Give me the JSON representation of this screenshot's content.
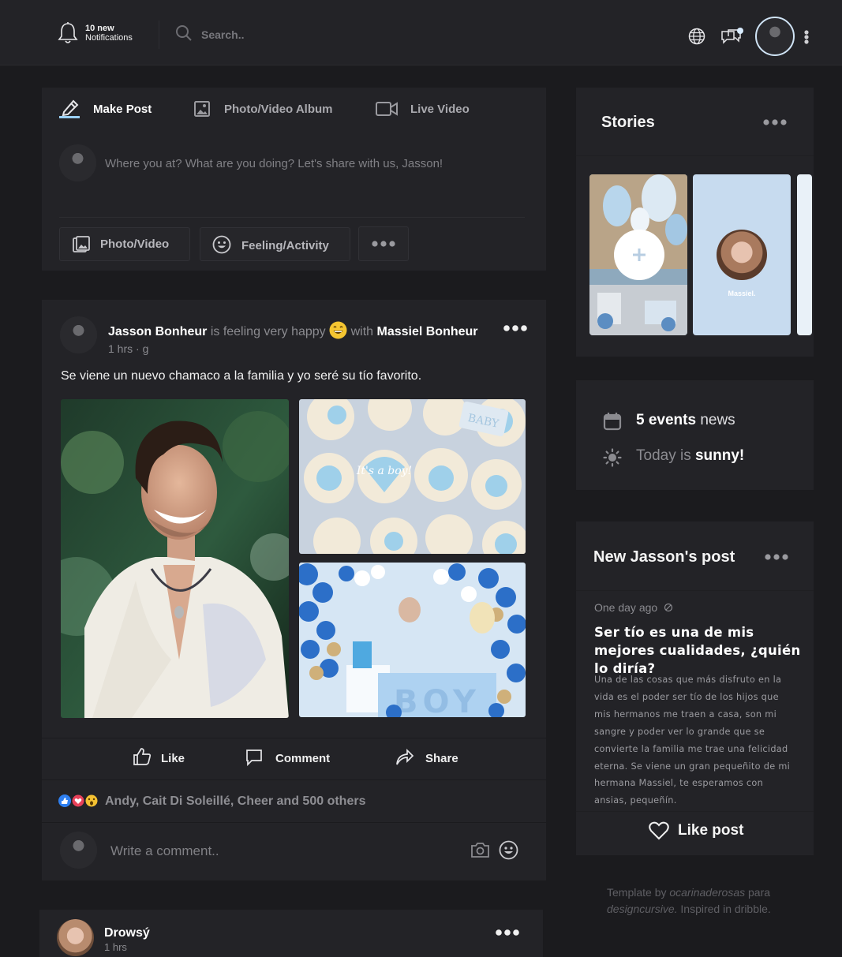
{
  "topbar": {
    "notif_count": "10 new",
    "notif_label": "Notifications",
    "search_placeholder": "Search.."
  },
  "composer": {
    "tabs": [
      {
        "label": "Make Post"
      },
      {
        "label": "Photo/Video Album"
      },
      {
        "label": "Live Video"
      }
    ],
    "placeholder": "Where you at? What are you doing? Let's share with us, Jasson!",
    "buttons": [
      {
        "label": "Photo/Video"
      },
      {
        "label": "Feeling/Activity"
      }
    ]
  },
  "post": {
    "author": "Jasson Bonheur",
    "feeling_text": "is feeling very happy",
    "with_text": "with",
    "tagged": "Massiel Bonheur",
    "time": "1 hrs",
    "privacy": "· g",
    "body": "Se viene un nuevo chamaco a la familia y yo seré su tío favorito.",
    "cupcake_text": "It's a boy!",
    "cupcake_badge": "BABY",
    "balloon_box_text": "BOY",
    "actions": [
      {
        "label": "Like"
      },
      {
        "label": "Comment"
      },
      {
        "label": "Share"
      }
    ],
    "reactions_text": "Andy, Cait Di Soleillé, Cheer and 500 others",
    "comment_placeholder": "Write a comment.."
  },
  "next_post": {
    "author": "Drowsý",
    "time": "1 hrs"
  },
  "stories": {
    "title": "Stories",
    "items": [
      {
        "name": "Massiel."
      }
    ]
  },
  "events": {
    "count": "5 events",
    "count_suffix": "news",
    "weather_prefix": "Today is",
    "weather": "sunny!"
  },
  "new_post": {
    "title": "New Jasson's post",
    "time": "One day ago",
    "headline": "Ser tío es una de mis mejores cualidades, ¿quién lo diría?",
    "body": "Una de las cosas que más disfruto en la vida es el poder ser tío de los hijos que mis hermanos me traen a casa, son mi sangre y poder ver lo grande que se convierte la familia me trae una felicidad eterna. Se viene un gran pequeñito de mi hermana Massiel, te esperamos con ansias, pequeñín.",
    "like_label": "Like post"
  },
  "footer": {
    "prefix": "Template by",
    "author": "ocarinaderosas",
    "middle": "para",
    "site": "designcursive.",
    "suffix": "Inspired in dribble."
  },
  "colors": {
    "page_bg": "#1b1b1e",
    "panel_bg": "#232327",
    "story_blue": "#c7dbef",
    "reaction_like": "#2e7ff0",
    "reaction_love": "#e8415a",
    "reaction_wow": "#f5c232"
  }
}
